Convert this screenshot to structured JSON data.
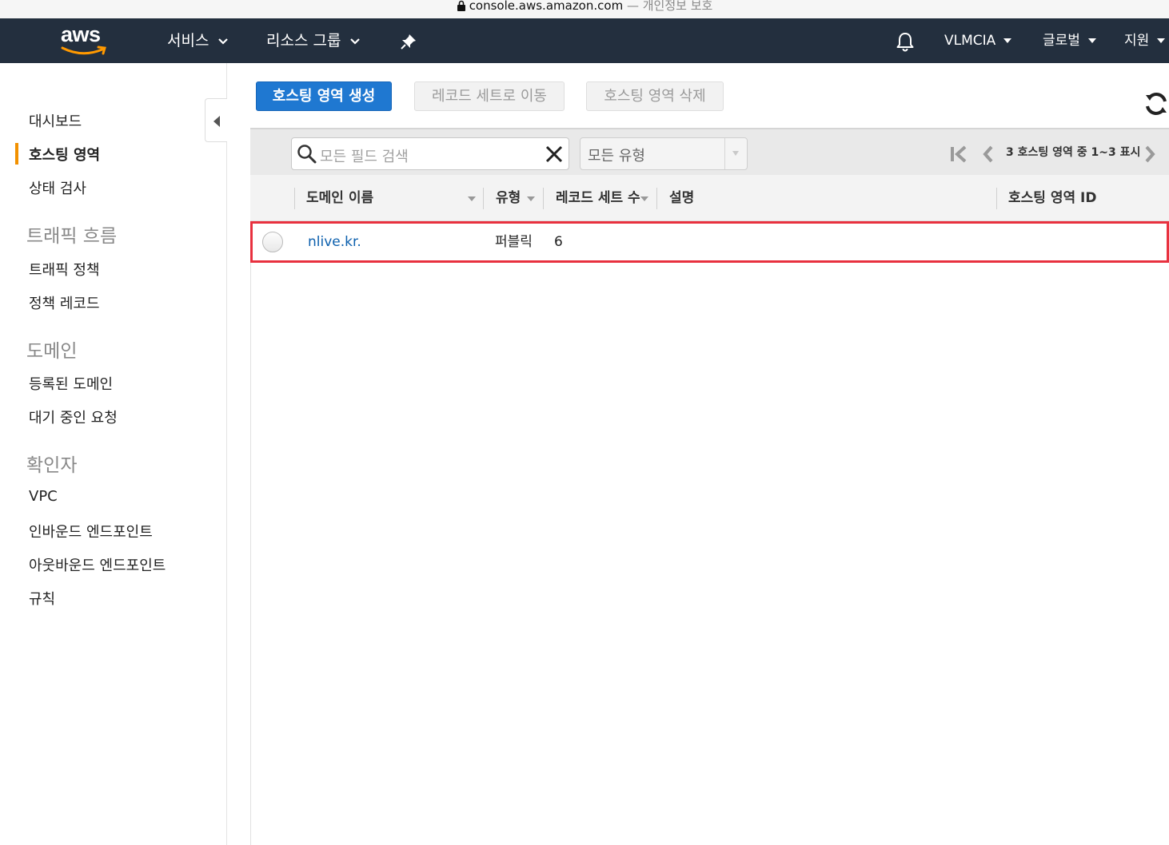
{
  "browser": {
    "domain": "console.aws.amazon.com",
    "privacy_note": "— 개인정보 보호"
  },
  "topnav": {
    "logo_text": "aws",
    "services": "서비스",
    "resource_groups": "리소스 그룹",
    "account": "VLMCIA",
    "region": "글로벌",
    "support": "지원"
  },
  "sidebar": {
    "items": [
      {
        "label": "대시보드"
      },
      {
        "label": "호스팅 영역",
        "active": true
      },
      {
        "label": "상태 검사"
      }
    ],
    "sections": [
      {
        "title": "트래픽 흐름",
        "items": [
          "트래픽 정책",
          "정책 레코드"
        ]
      },
      {
        "title": "도메인",
        "items": [
          "등록된 도메인",
          "대기 중인 요청"
        ]
      },
      {
        "title": "확인자",
        "items": [
          "VPC",
          "인바운드 엔드포인트",
          "아웃바운드 엔드포인트",
          "규칙"
        ]
      }
    ]
  },
  "toolbar": {
    "create": "호스팅 영역 생성",
    "migrate": "레코드 세트로 이동",
    "delete": "호스팅 영역 삭제"
  },
  "filter": {
    "search_placeholder": "모든 필드 검색",
    "type_select": "모든 유형",
    "pagination": "3 호스팅 영역 중 1~3 표시"
  },
  "table": {
    "columns": [
      "도메인 이름",
      "유형",
      "레코드 세트 수",
      "설명",
      "호스팅 영역 ID"
    ],
    "rows": [
      {
        "domain": "nlive.kr.",
        "type": "퍼블릭",
        "record_count": "6",
        "description": "",
        "zone_id": ""
      }
    ]
  },
  "colors": {
    "nav_bg": "#232f3e",
    "primary": "#1f78d1",
    "active_indicator": "#f29100",
    "highlight": "#e8313f",
    "link": "#0b5fad"
  }
}
